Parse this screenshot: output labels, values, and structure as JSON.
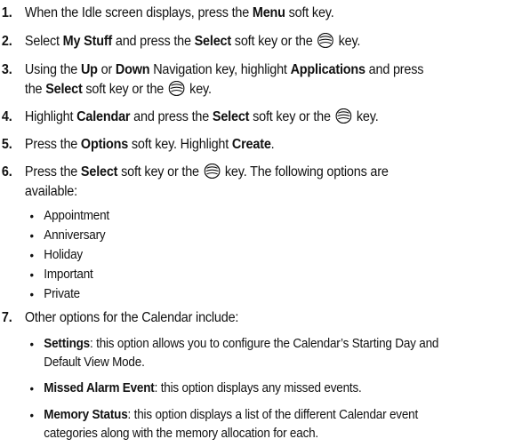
{
  "steps": [
    {
      "num": "1.",
      "line1": [
        "When the Idle screen displays, press the ",
        "Menu",
        " soft key."
      ]
    },
    {
      "num": "2.",
      "line1": [
        "Select ",
        "My Stuff",
        " and press the ",
        "Select",
        " soft key or the ",
        " key."
      ]
    },
    {
      "num": "3.",
      "line1": [
        "Using the ",
        "Up",
        " or ",
        "Down",
        " Navigation key, highlight ",
        "Applications",
        " and press"
      ],
      "line2": [
        "the ",
        "Select",
        " soft key or the ",
        " key."
      ]
    },
    {
      "num": "4.",
      "line1": [
        "Highlight ",
        "Calendar",
        " and press the ",
        "Select",
        " soft key or the ",
        " key."
      ]
    },
    {
      "num": "5.",
      "line1": [
        "Press the ",
        "Options",
        " soft key. Highlight ",
        "Create",
        "."
      ]
    },
    {
      "num": "6.",
      "line1": [
        "Press the ",
        "Select",
        " soft key or the ",
        " key. The following options are"
      ],
      "line2": "available:"
    },
    {
      "num": "7.",
      "line1": "Other options for the Calendar include:"
    }
  ],
  "options": [
    "Appointment",
    "Anniversary",
    "Holiday",
    "Important",
    "Private"
  ],
  "calendar_options": [
    {
      "term": "Settings",
      "desc1": ": this option allows you to configure the Calendar’s Starting Day and",
      "desc2": "Default View Mode."
    },
    {
      "term": "Missed Alarm Event",
      "desc1": ": this option displays any missed events."
    },
    {
      "term": "Memory Status",
      "desc1": ": this option displays a list of the different Calendar event",
      "desc2": "categories along with the memory allocation for each."
    }
  ],
  "bullet_glyph": "•",
  "icon": "navigation-center-key-icon"
}
